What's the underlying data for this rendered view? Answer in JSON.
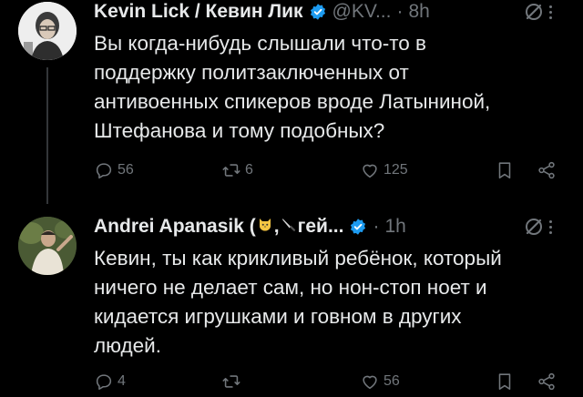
{
  "tweets": [
    {
      "author_name": "Kevin Lick / Кевин Лик",
      "handle": "@KV...",
      "dot": "·",
      "time": "8h",
      "text": "Вы когда-нибудь слышали что-то в\nподдержку политзаключенных от\nантивоенных спикеров вроде Латыниной,\nШтефанова и тому подобных?",
      "replies": "56",
      "reposts": "6",
      "likes": "125"
    },
    {
      "author_name_prefix": "Andrei Apanasik (",
      "author_name_mid": ",",
      "author_name_suffix": "гей...",
      "dot": "·",
      "time": "1h",
      "text": "Кевин, ты как крикливый ребёнок, который\nничего не делает сам, но нон-стоп ноет и\nкидается игрушками и говном в других\nлюдей.",
      "replies": "4",
      "reposts": "",
      "likes": "56"
    }
  ],
  "icons": [
    "verified-badge-icon",
    "grok-slash-icon",
    "more-icon",
    "reply-icon",
    "repost-icon",
    "like-icon",
    "bookmark-icon",
    "share-icon",
    "cat-emoji-icon",
    "knife-emoji-icon"
  ],
  "colors": {
    "background": "#000000",
    "text": "#e7e9ea",
    "muted": "#71767b",
    "verified": "#1d9bf0"
  }
}
